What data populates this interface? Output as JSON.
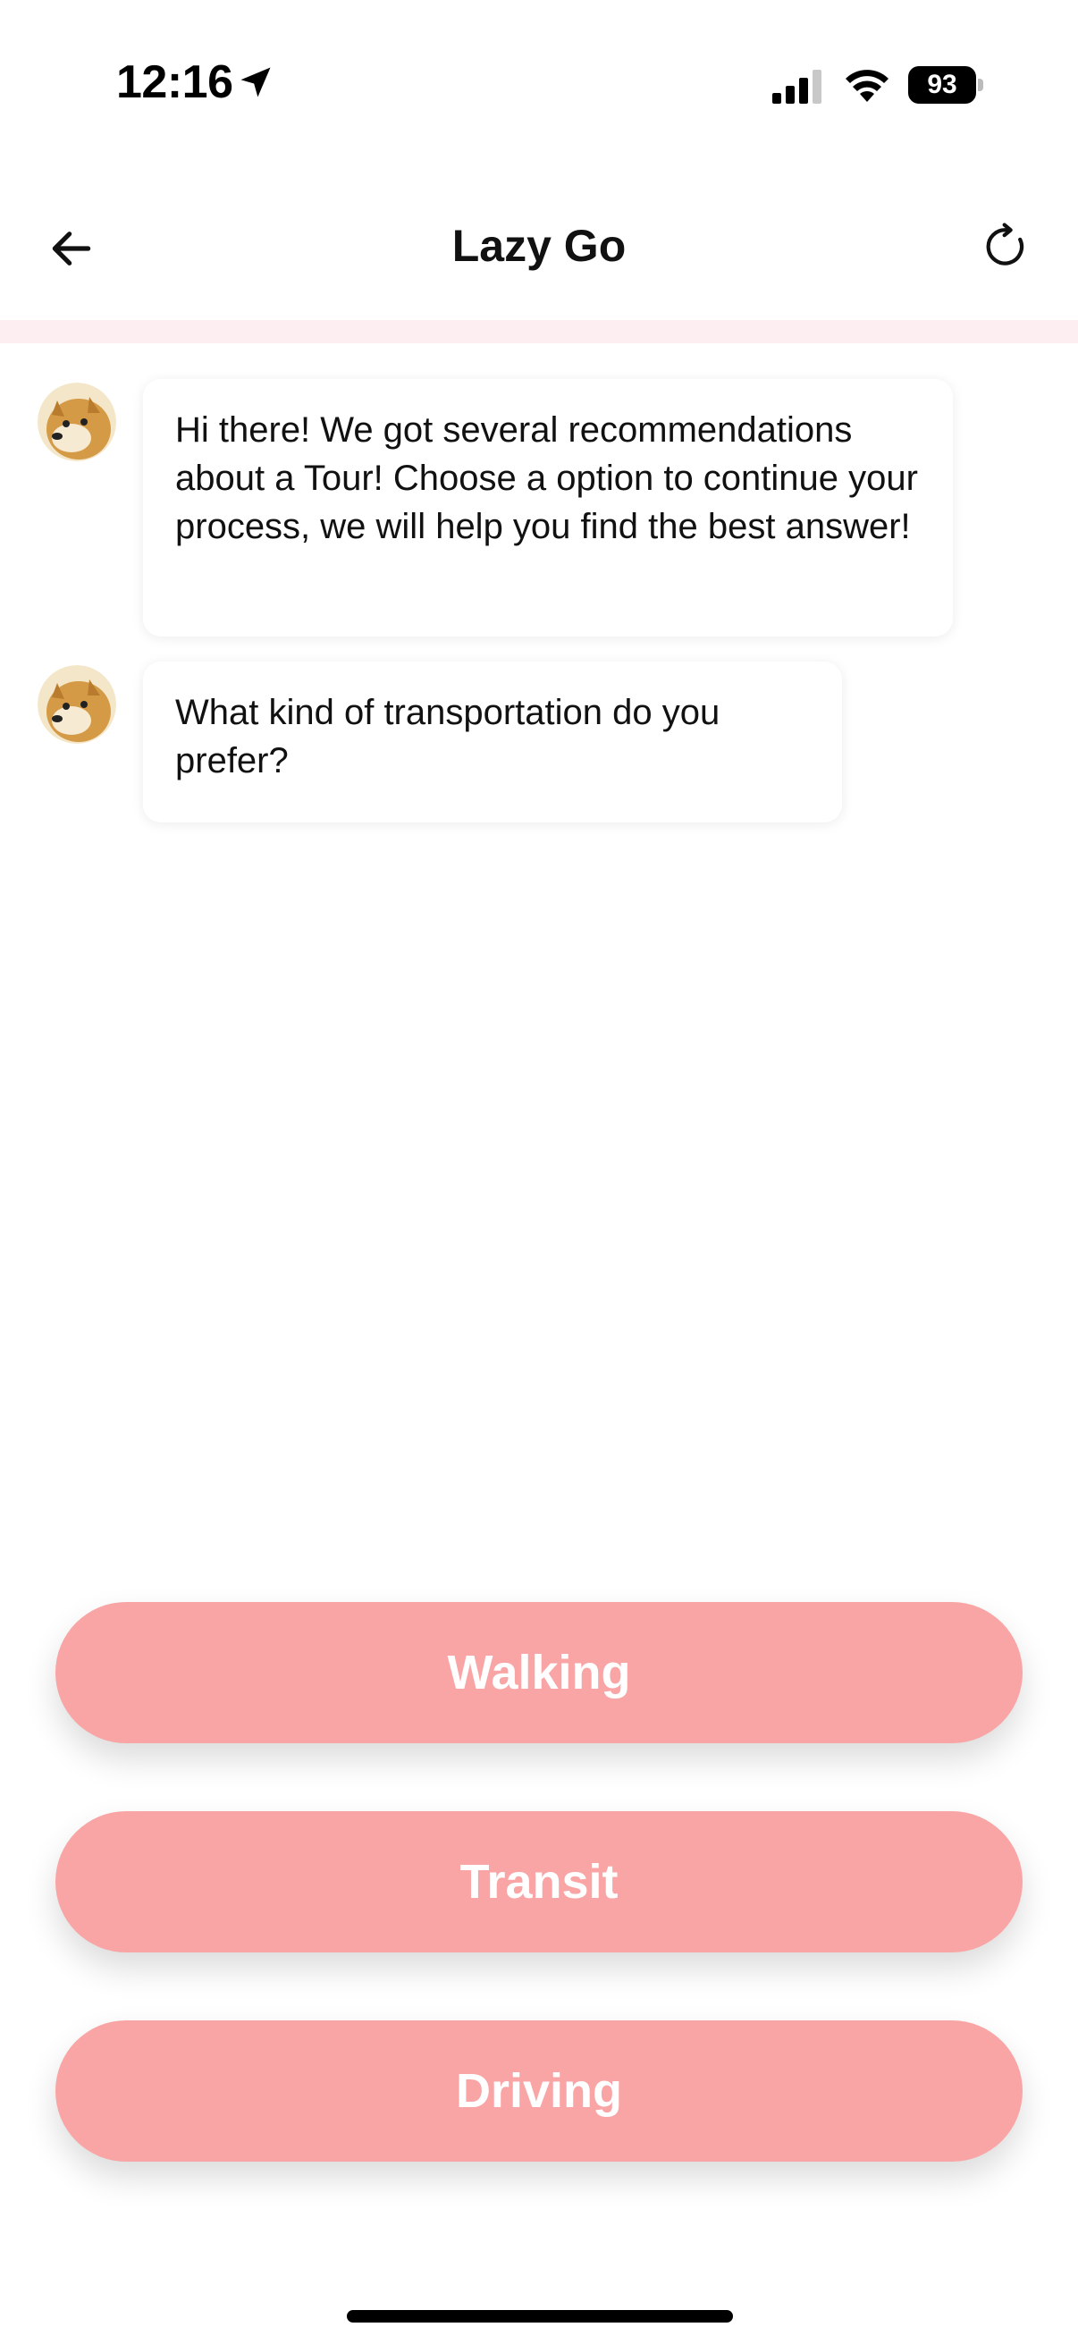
{
  "status_bar": {
    "time": "12:16",
    "battery": "93"
  },
  "header": {
    "title": "Lazy Go"
  },
  "messages": [
    {
      "text": "Hi there! We got several recommendations about a Tour! Choose a option to continue your process, we will help you find the best answer!"
    },
    {
      "text": "What kind of transportation do you prefer?"
    }
  ],
  "options": [
    {
      "label": "Walking"
    },
    {
      "label": "Transit"
    },
    {
      "label": "Driving"
    }
  ],
  "colors": {
    "button": "#f9a5a5",
    "divider": "#fdeef1"
  },
  "icons": [
    "location-arrow-icon",
    "signal-icon",
    "wifi-icon",
    "battery-icon",
    "back-arrow-icon",
    "refresh-icon",
    "doge-avatar-icon"
  ]
}
